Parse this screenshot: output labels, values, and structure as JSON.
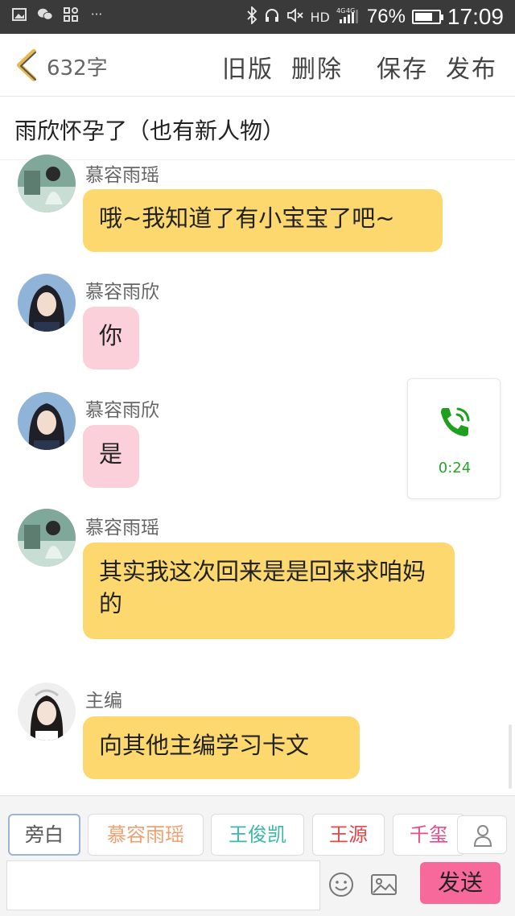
{
  "status_bar": {
    "network": "HD",
    "signal_label": "4G 4G",
    "battery_percent": "76%",
    "battery_level": 0.76,
    "time": "17:09",
    "more": "···"
  },
  "header": {
    "word_count": "632字",
    "buttons": [
      "旧版",
      "删除",
      "保存",
      "发布"
    ]
  },
  "story_title": "雨欣怀孕了（也有新人物）",
  "messages": [
    {
      "sender": "慕容雨瑶",
      "text": "哦~我知道了有小宝宝了吧~",
      "color": "yellow"
    },
    {
      "sender": "慕容雨欣",
      "text": "你",
      "color": "pink"
    },
    {
      "sender": "慕容雨欣",
      "text": "是",
      "color": "pink"
    },
    {
      "sender": "慕容雨瑶",
      "text": "其实我这次回来是是回来求咱妈的",
      "color": "yellow"
    },
    {
      "sender": "主编",
      "text": "向其他主编学习卡文",
      "color": "yellow"
    }
  ],
  "call_card": {
    "duration": "0:24",
    "icon": "phone-icon"
  },
  "characters": [
    {
      "label": "旁白",
      "color": "#555555"
    },
    {
      "label": "慕容雨瑶",
      "color": "#f0a070"
    },
    {
      "label": "王俊凯",
      "color": "#3bb8a8"
    },
    {
      "label": "王源",
      "color": "#e04848"
    },
    {
      "label": "千玺",
      "color": "#e84a8a"
    }
  ],
  "input": {
    "placeholder": ""
  },
  "send_label": "发送",
  "colors": {
    "yellow_bubble": "#fcd86e",
    "pink_bubble": "#fcd0db",
    "send_button": "#f8699b",
    "call_green": "#2aa52a"
  }
}
